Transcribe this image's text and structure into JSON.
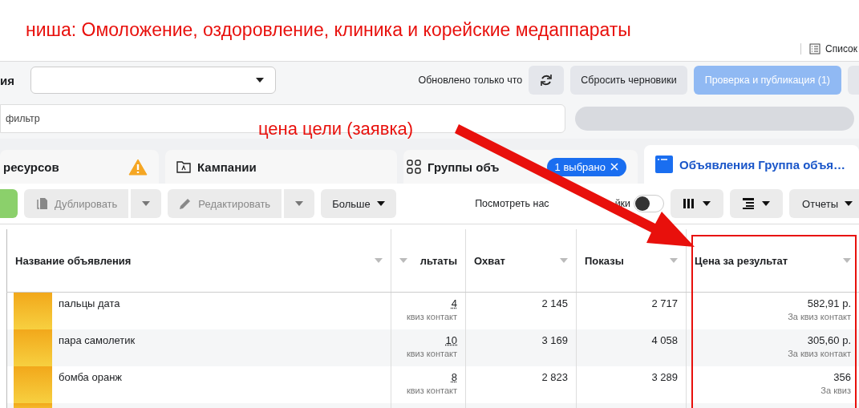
{
  "annotations": {
    "title": "ниша: Омоложение, оздоровление, клиника и корейские медаппараты",
    "note": "цена цели (заявка)"
  },
  "list_button": "Список",
  "topbar": {
    "label": "ия",
    "updated": "Обновлено только что",
    "reset": "Сбросить черновики",
    "publish": {
      "label": "Проверка и публикация (1)",
      "disabled": true
    }
  },
  "filter": {
    "placeholder": "фильтр"
  },
  "tabs": [
    {
      "label": "ресурсов",
      "kind": "account",
      "selected": false,
      "warning": true
    },
    {
      "label": "Кампании",
      "kind": "campaign",
      "selected": false,
      "warning": false
    },
    {
      "label": "Группы объ",
      "kind": "adset",
      "selected": false,
      "warning": false,
      "chip": "1 выбрано"
    },
    {
      "label": "Объявления Группа объя…",
      "kind": "ad",
      "selected": true,
      "warning": false
    }
  ],
  "actions": [
    {
      "label": "Дублировать",
      "kind": "copy",
      "disabled": true
    },
    {
      "label": "Редактировать",
      "kind": "edit",
      "disabled": true
    },
    {
      "label": "Больше",
      "kind": "more",
      "disabled": false
    }
  ],
  "view_settings": {
    "label_start": "Посмотреть нас",
    "label_end": "йки",
    "on": false
  },
  "reports": "Отчеты",
  "table": {
    "columns": [
      "Название объявления",
      "льтаты",
      "Охват",
      "Показы",
      "Цена за результат"
    ],
    "rows": [
      {
        "name": "пальцы дата",
        "results": "4",
        "result_type": "квиз контакт",
        "reach": "2 145",
        "impressions": "2 717",
        "cost": "582,91 р.",
        "cost_type": "За квиз контакт"
      },
      {
        "name": "пара самолетик",
        "results": "10",
        "result_type": "квиз контакт",
        "reach": "3 169",
        "impressions": "4 058",
        "cost": "305,60 р.",
        "cost_type": "За квиз контакт"
      },
      {
        "name": "бомба оранж",
        "results": "8",
        "result_type": "квиз контакт",
        "reach": "2 823",
        "impressions": "3 289",
        "cost": "356",
        "cost_type": "За квиз"
      }
    ]
  }
}
